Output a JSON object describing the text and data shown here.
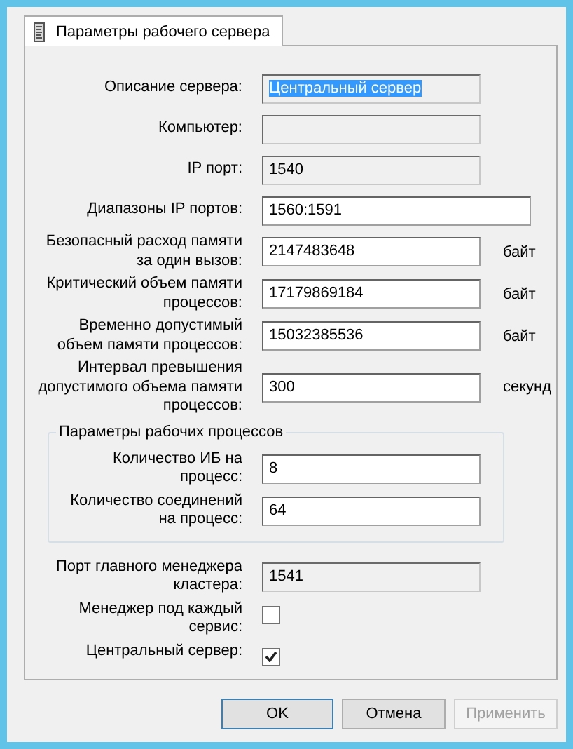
{
  "tabs": [
    {
      "label": "Параметры рабочего сервера",
      "selected": true
    }
  ],
  "fields": [
    {
      "kind": "text",
      "label": "Описание сервера:",
      "value": "Центральный сервер",
      "readonly": true,
      "selected": true
    },
    {
      "kind": "text",
      "label": "Компьютер:",
      "readonly": true
    },
    {
      "kind": "text",
      "label": "IP порт:",
      "value": "1540",
      "readonly": true,
      "selected": false
    },
    {
      "kind": "text",
      "label": "Диапазоны IP портов:",
      "value": "1560:1591",
      "readonly": false,
      "selected": false,
      "wide": true
    },
    {
      "kind": "text",
      "label": "Безопасный расход памяти за один вызов:",
      "value": "2147483648",
      "readonly": false,
      "selected": false,
      "unit": "байт"
    },
    {
      "kind": "text",
      "label": "Критический объем памяти процессов:",
      "value": "17179869184",
      "readonly": false,
      "selected": false,
      "unit": "байт"
    },
    {
      "kind": "text",
      "label": "Временно допустимый объем памяти процессов:",
      "value": "15032385536",
      "readonly": false,
      "selected": false,
      "unit": "байт"
    },
    {
      "kind": "text",
      "label": "Интервал превышения допустимого объема памяти процессов:",
      "value": "300",
      "readonly": false,
      "selected": false,
      "unit": "секунд"
    },
    {
      "kind": "group",
      "title": "Параметры рабочих процессов",
      "children": [
        {
          "kind": "text",
          "label": "Количество ИБ на процесс:",
          "value": "8",
          "readonly": false,
          "selected": false
        },
        {
          "kind": "text",
          "label": "Количество соединений на процесс:",
          "value": "64",
          "readonly": false,
          "selected": false
        }
      ]
    },
    {
      "kind": "text",
      "label": "Порт главного менеджера кластера:",
      "value": "1541",
      "readonly": true,
      "selected": false
    },
    {
      "kind": "checkbox",
      "label": "Менеджер под каждый сервис:",
      "checked": false
    },
    {
      "kind": "checkbox",
      "label": "Центральный сервер:",
      "checked": true
    }
  ],
  "buttons": [
    {
      "label": "OK",
      "disabled": false,
      "default": true
    },
    {
      "label": "Отмена",
      "disabled": false,
      "default": false
    },
    {
      "label": "Применить",
      "disabled": true,
      "default": false
    }
  ]
}
